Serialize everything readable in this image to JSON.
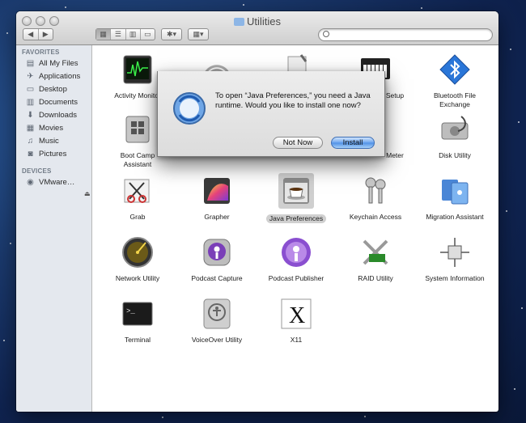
{
  "window": {
    "title": "Utilities"
  },
  "toolbar": {
    "back": "◀",
    "forward": "▶",
    "views": [
      "▦",
      "☰",
      "▥",
      "▭"
    ],
    "action": "✱▾",
    "arrange": "▦▾",
    "search_placeholder": ""
  },
  "sidebar": {
    "favorites_header": "FAVORITES",
    "favorites": [
      {
        "label": "All My Files",
        "icon": "all-files-icon"
      },
      {
        "label": "Applications",
        "icon": "applications-icon"
      },
      {
        "label": "Desktop",
        "icon": "desktop-icon"
      },
      {
        "label": "Documents",
        "icon": "documents-icon"
      },
      {
        "label": "Downloads",
        "icon": "downloads-icon"
      },
      {
        "label": "Movies",
        "icon": "movies-icon"
      },
      {
        "label": "Music",
        "icon": "music-icon"
      },
      {
        "label": "Pictures",
        "icon": "pictures-icon"
      }
    ],
    "devices_header": "DEVICES",
    "devices": [
      {
        "label": "VMware…",
        "icon": "disk-icon"
      }
    ]
  },
  "apps": [
    {
      "label": "Activity Monitor"
    },
    {
      "label": ""
    },
    {
      "label": ""
    },
    {
      "label": "Setup"
    },
    {
      "label": "Bluetooth File Exchange"
    },
    {
      "label": "Boot Camp Assistant"
    },
    {
      "label": ""
    },
    {
      "label": ""
    },
    {
      "label": "Meter"
    },
    {
      "label": "Disk Utility"
    },
    {
      "label": "Grab"
    },
    {
      "label": "Grapher"
    },
    {
      "label": "Java Preferences"
    },
    {
      "label": "Keychain Access"
    },
    {
      "label": "Migration Assistant"
    },
    {
      "label": "Network Utility"
    },
    {
      "label": "Podcast Capture"
    },
    {
      "label": "Podcast Publisher"
    },
    {
      "label": "RAID Utility"
    },
    {
      "label": "System Information"
    },
    {
      "label": "Terminal"
    },
    {
      "label": "VoiceOver Utility"
    },
    {
      "label": "X11"
    }
  ],
  "dialog": {
    "message": "To open “Java Preferences,” you need a Java runtime. Would you like to install one now?",
    "cancel": "Not Now",
    "confirm": "Install"
  },
  "colors": {
    "accent": "#4e8fe6",
    "sidebar_bg": "#e4e8ee",
    "desktop": "#1b3a6e"
  }
}
